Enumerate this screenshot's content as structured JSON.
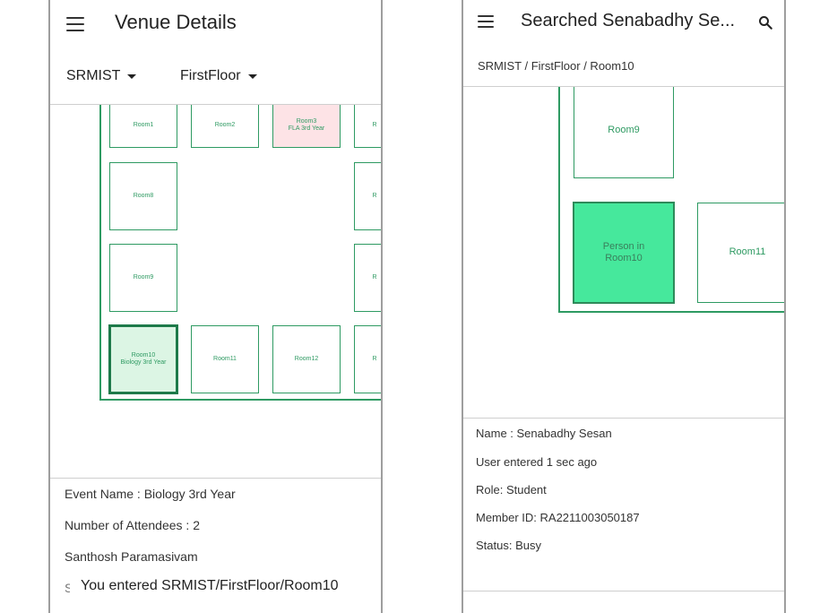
{
  "left": {
    "title": "Venue Details",
    "dropdown_campus": "SRMIST",
    "dropdown_floor": "FirstFloor",
    "rooms": {
      "room1": "Room1",
      "room2": "Room2",
      "room3_name": "Room3",
      "room3_event": "FLA 3rd Year",
      "room8": "Room8",
      "room9": "Room9",
      "room10_name": "Room10",
      "room10_event": "Biology 3rd Year",
      "room11": "Room11",
      "room12": "Room12",
      "edge_label": "R"
    },
    "event_name": "Event Name : Biology 3rd Year",
    "attendees": "Number of Attendees : 2",
    "attendee_name": "Santhosh Paramasivam",
    "toast": "You entered SRMIST/FirstFloor/Room10",
    "hidden_glyph": "S"
  },
  "right": {
    "title": "Searched Senabadhy Se...",
    "breadcrumb": "SRMIST / FirstFloor / Room10",
    "rooms": {
      "room9": "Room9",
      "person_l1": "Person in",
      "person_l2": "Room10",
      "room11": "Room11"
    },
    "name": "Name : Senabadhy Sesan",
    "entered": "User entered 1 sec ago",
    "role": "Role: Student",
    "member_id": "Member ID: RA2211003050187",
    "status": "Status: Busy"
  },
  "colors": {
    "room_outline": "#2e9a62",
    "selected_fill": "#dcf5e4",
    "pink_fill": "#fde3e6",
    "person_fill": "#46e89c"
  },
  "icons": [
    "menu-icon",
    "dropdown-caret-icon",
    "search-icon"
  ]
}
